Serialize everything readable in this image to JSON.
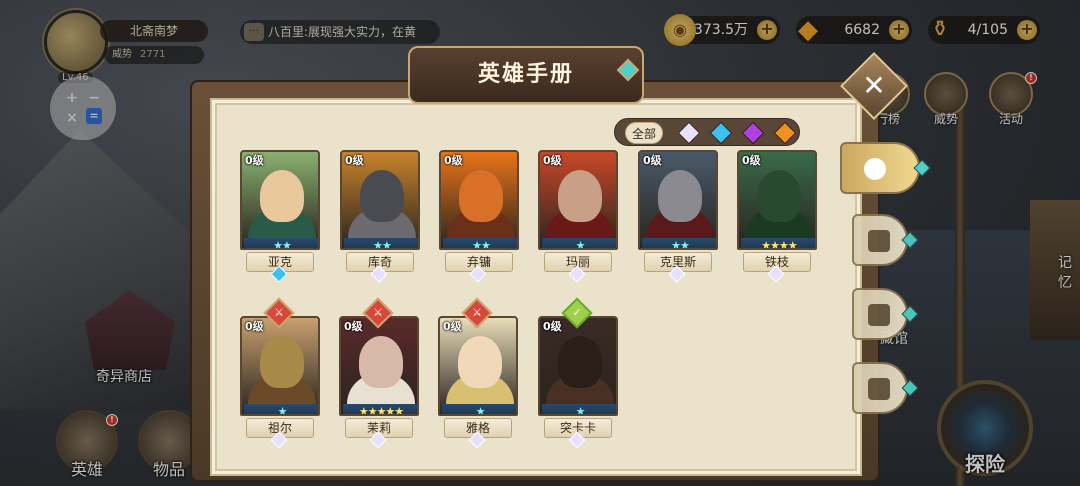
{
  "player": {
    "name": "北斋南梦",
    "power_label": "威势",
    "power_value": "2771",
    "level": "Lv.46"
  },
  "chat": {
    "text": "八百里:展现强大实力，在黄"
  },
  "resources": {
    "gold": "373.5万",
    "gems": "6682",
    "stamina": "4/105"
  },
  "top_menu": [
    {
      "label": "行榜"
    },
    {
      "label": "威势"
    },
    {
      "label": "活动"
    }
  ],
  "bottom_menu": {
    "hero": "英雄",
    "items": "物品"
  },
  "places": {
    "shop": "奇异商店",
    "museum": "藏馆",
    "memory": "记忆"
  },
  "explore": "探险",
  "dialog": {
    "title": "英雄手册",
    "filter_all": "全部",
    "filter_colors": [
      "#e8e0ff",
      "#3cc0f0",
      "#b040e0",
      "#f09020"
    ]
  },
  "heroes": [
    {
      "name": "亚克",
      "level": "0级",
      "stars": "★★",
      "star_color": "blue",
      "quality": "#3cc0f0",
      "bg": "#8ab070",
      "face": "#e8c89c",
      "body": "#2a5a48"
    },
    {
      "name": "库奇",
      "level": "0级",
      "stars": "★★",
      "star_color": "blue",
      "quality": "#e8e0ff",
      "bg": "#c8842c",
      "face": "#4a4a52",
      "body": "#6a6a70"
    },
    {
      "name": "弃镛",
      "level": "0级",
      "stars": "★★",
      "star_color": "blue",
      "quality": "#e8e0ff",
      "bg": "#e87418",
      "face": "#d8702a",
      "body": "#6a3018"
    },
    {
      "name": "玛丽",
      "level": "0级",
      "stars": "★",
      "star_color": "blue",
      "quality": "#e8e0ff",
      "bg": "#c84828",
      "face": "#c8a088",
      "body": "#6a1818"
    },
    {
      "name": "克里斯",
      "level": "0级",
      "stars": "★★",
      "star_color": "blue",
      "quality": "#e8e0ff",
      "bg": "#4a5a6a",
      "face": "#8a8a90",
      "body": "#5a1a1a"
    },
    {
      "name": "铁枝",
      "level": "0级",
      "stars": "★★★★",
      "star_color": "gold",
      "quality": "#e8e0ff",
      "bg": "#3a6a4a",
      "face": "#2a4a30",
      "body": "#1a3a22"
    },
    {
      "name": "祖尔",
      "level": "0级",
      "stars": "★",
      "star_color": "blue",
      "quality": "#e8e0ff",
      "bg": "#c8a070",
      "face": "#a88a48",
      "body": "#6a4a28",
      "badge": "red"
    },
    {
      "name": "茉莉",
      "level": "0级",
      "stars": "★★★★★",
      "star_color": "gold",
      "quality": "#e8e0ff",
      "bg": "#5a2a2a",
      "face": "#d8b8a8",
      "body": "#e8e0d0",
      "badge": "red"
    },
    {
      "name": "雅格",
      "level": "0级",
      "stars": "★",
      "star_color": "blue",
      "quality": "#e8e0ff",
      "bg": "#e8dcb8",
      "face": "#f0d8b8",
      "body": "#d8c070",
      "badge": "red"
    },
    {
      "name": "突卡卡",
      "level": "0级",
      "stars": "★",
      "star_color": "blue",
      "quality": "#e8e0ff",
      "bg": "#3a2a24",
      "face": "#2a1e18",
      "body": "#4a3024",
      "badge": "green"
    }
  ]
}
